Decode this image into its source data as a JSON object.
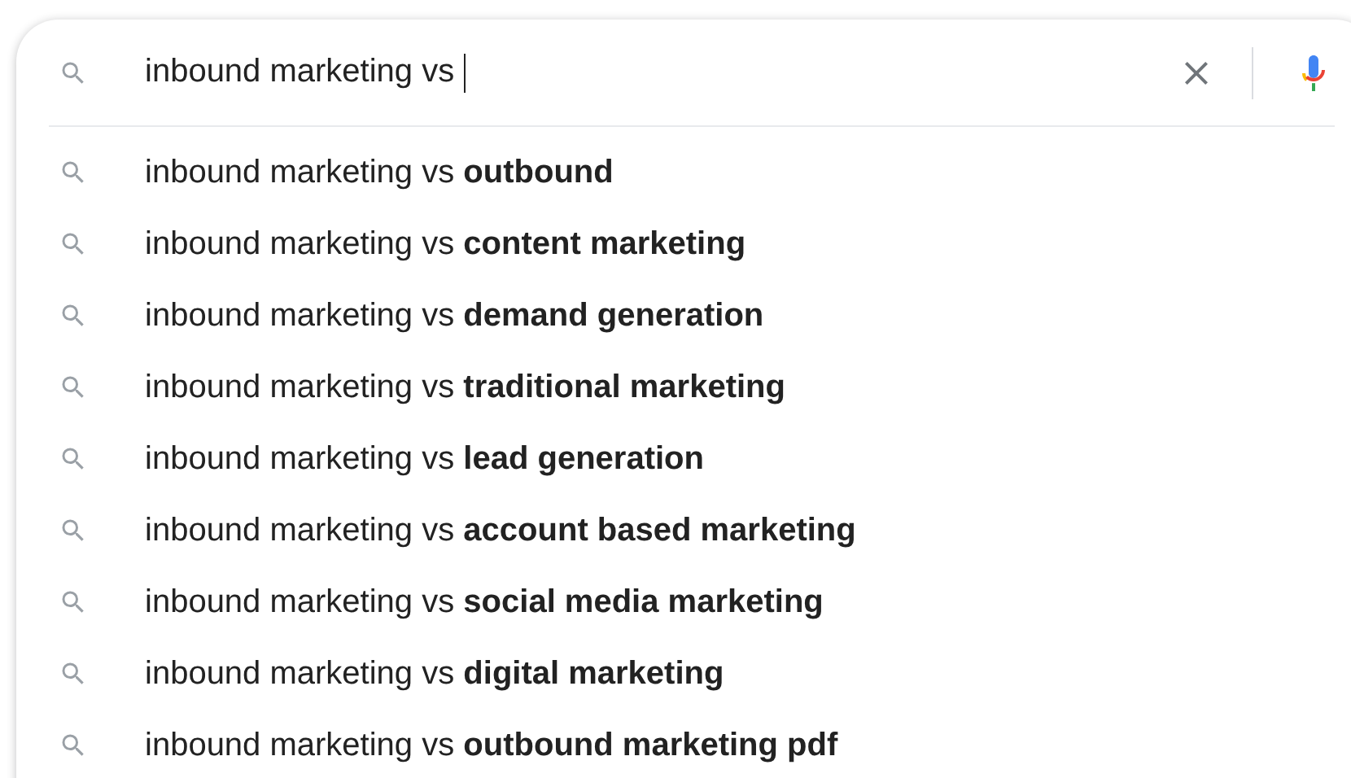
{
  "search": {
    "value": "inbound marketing vs ",
    "focused": true
  },
  "suggestions": [
    {
      "text": "inbound marketing vs **outbound**"
    },
    {
      "text": "inbound marketing vs **content marketing**"
    },
    {
      "text": "inbound marketing vs **demand generation**"
    },
    {
      "text": "inbound marketing vs **traditional marketing**"
    },
    {
      "text": "inbound marketing vs **lead generation**"
    },
    {
      "text": "inbound marketing vs **account based marketing**"
    },
    {
      "text": "inbound marketing vs **social media marketing**"
    },
    {
      "text": "inbound marketing vs **digital marketing**"
    },
    {
      "text": "inbound marketing vs **outbound marketing pdf**"
    }
  ]
}
